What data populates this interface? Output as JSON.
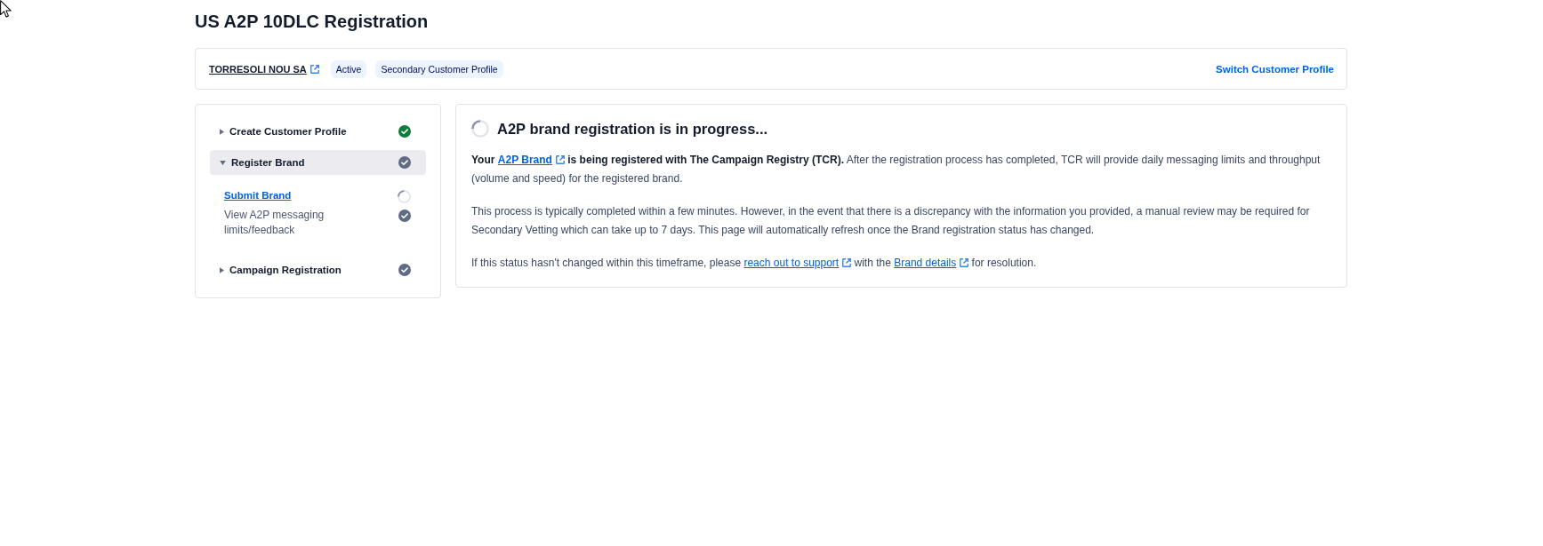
{
  "page_title": "US A2P 10DLC Registration",
  "profile_bar": {
    "name": "TORRESOLI NOU SA",
    "badges": [
      "Active",
      "Secondary Customer Profile"
    ],
    "switch_link": "Switch Customer Profile"
  },
  "steps": [
    {
      "label": "Create Customer Profile",
      "expanded": false,
      "selected": false,
      "completed": true,
      "in_progress": false
    },
    {
      "label": "Register Brand",
      "expanded": true,
      "selected": true,
      "completed": false,
      "in_progress": false,
      "children": [
        {
          "label": "Submit Brand",
          "kind": "link",
          "in_progress": true
        },
        {
          "label": "View A2P messaging limits/feedback",
          "kind": "text",
          "completed": false,
          "in_progress": false
        }
      ]
    },
    {
      "label": "Campaign Registration",
      "expanded": false,
      "selected": false,
      "completed": false,
      "in_progress": false
    }
  ],
  "status_panel": {
    "in_progress": true,
    "heading": "A2P brand registration is in progress...",
    "paragraphs": [
      [
        {
          "kind": "text",
          "text": "**Your** "
        },
        {
          "kind": "link",
          "text": "A2P Brand",
          "bold": true
        },
        {
          "kind": "text",
          "text": " **is being registered with The Campaign Registry (TCR).** After the registration process has completed, TCR will provide daily messaging limits and throughput (volume and speed) for the registered brand."
        }
      ],
      [
        {
          "kind": "text",
          "text": "This process is typically completed within a few minutes. However, in the event that there is a discrepancy with the information you provided, a manual review may be required for Secondary Vetting which can take up to 7 days. This page will automatically refresh once the Brand registration status has changed."
        }
      ],
      [
        {
          "kind": "text",
          "text": "If this status hasn't changed within this timeframe, please "
        },
        {
          "kind": "link",
          "text": "reach out to support",
          "bold": false
        },
        {
          "kind": "text",
          "text": " with the "
        },
        {
          "kind": "link",
          "text": "Brand details",
          "bold": false
        },
        {
          "kind": "text",
          "text": " for resolution."
        }
      ]
    ]
  }
}
